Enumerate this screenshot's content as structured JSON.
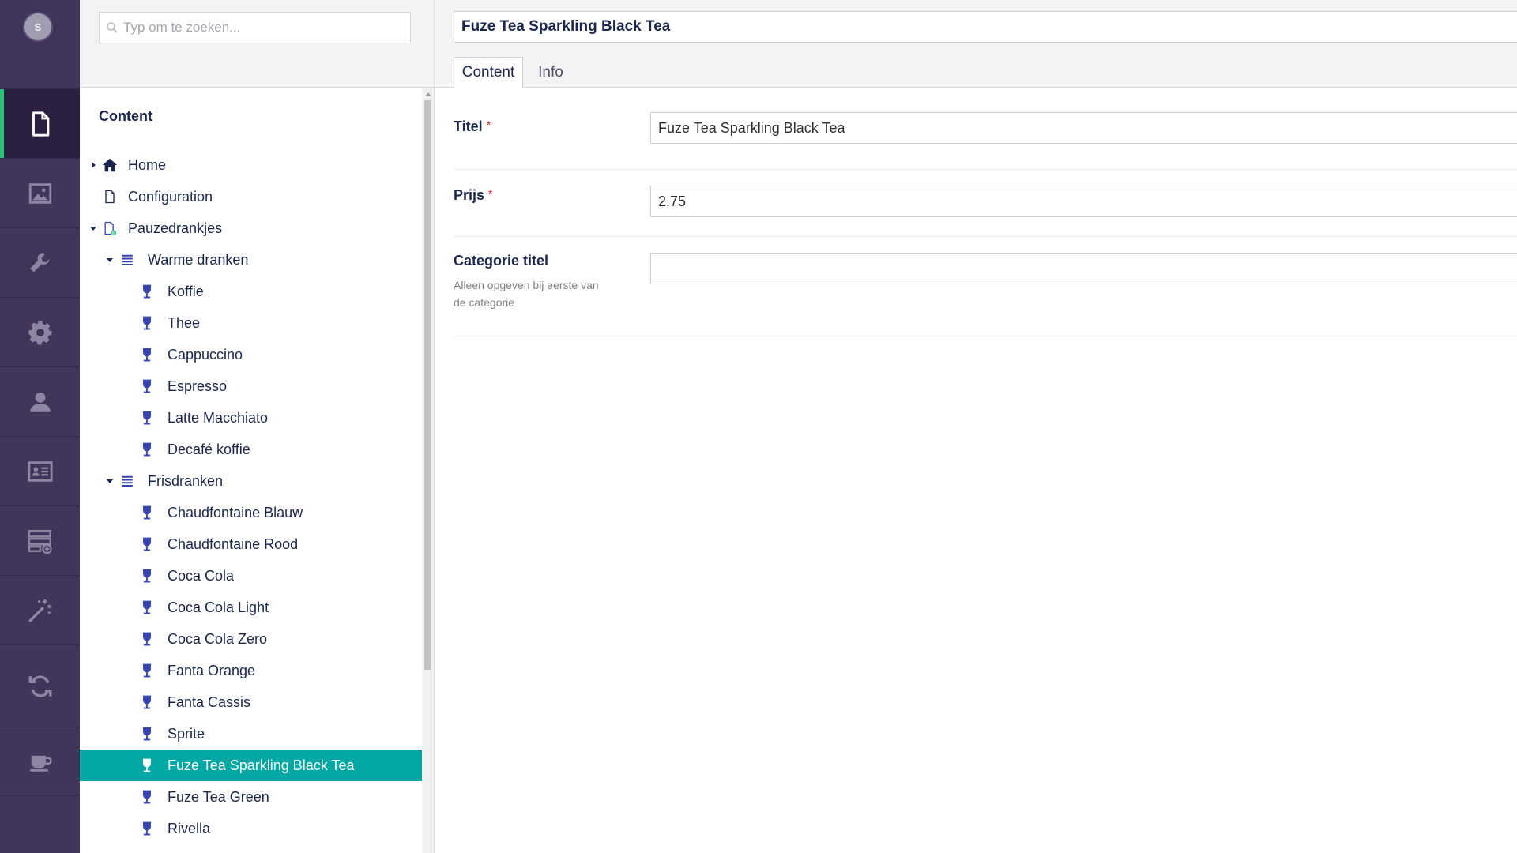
{
  "user": {
    "initial": "S"
  },
  "sections": [
    {
      "name": "content",
      "icon": "document-icon",
      "active": true
    },
    {
      "name": "media",
      "icon": "image-icon",
      "active": false
    },
    {
      "name": "settings",
      "icon": "wrench-icon",
      "active": false
    },
    {
      "name": "packages",
      "icon": "gear-icon",
      "active": false
    },
    {
      "name": "users",
      "icon": "user-icon",
      "active": false
    },
    {
      "name": "members",
      "icon": "id-card-icon",
      "active": false
    },
    {
      "name": "forms",
      "icon": "form-add-icon",
      "active": false
    },
    {
      "name": "translation",
      "icon": "magic-wand-icon",
      "active": false
    },
    {
      "name": "deploy",
      "icon": "sync-icon",
      "active": false
    },
    {
      "name": "coffee",
      "icon": "coffee-cup-icon",
      "active": false
    }
  ],
  "search": {
    "placeholder": "Typ om te zoeken..."
  },
  "tree": {
    "root_label": "Content",
    "nodes": [
      {
        "label": "Home",
        "level": 0,
        "icon": "home-icon",
        "caret": "right"
      },
      {
        "label": "Configuration",
        "level": 0,
        "icon": "page-icon",
        "caret": ""
      },
      {
        "label": "Pauzedrankjes",
        "level": 0,
        "icon": "page-plus-icon",
        "caret": "down"
      },
      {
        "label": "Warme dranken",
        "level": 1,
        "icon": "list-icon",
        "caret": "down"
      },
      {
        "label": "Koffie",
        "level": 2,
        "icon": "glass-icon",
        "caret": ""
      },
      {
        "label": "Thee",
        "level": 2,
        "icon": "glass-icon",
        "caret": ""
      },
      {
        "label": "Cappuccino",
        "level": 2,
        "icon": "glass-icon",
        "caret": ""
      },
      {
        "label": "Espresso",
        "level": 2,
        "icon": "glass-icon",
        "caret": ""
      },
      {
        "label": "Latte Macchiato",
        "level": 2,
        "icon": "glass-icon",
        "caret": ""
      },
      {
        "label": "Decafé koffie",
        "level": 2,
        "icon": "glass-icon",
        "caret": ""
      },
      {
        "label": "Frisdranken",
        "level": 1,
        "icon": "list-icon",
        "caret": "down"
      },
      {
        "label": "Chaudfontaine Blauw",
        "level": 2,
        "icon": "glass-icon",
        "caret": ""
      },
      {
        "label": "Chaudfontaine Rood",
        "level": 2,
        "icon": "glass-icon",
        "caret": ""
      },
      {
        "label": "Coca Cola",
        "level": 2,
        "icon": "glass-icon",
        "caret": ""
      },
      {
        "label": "Coca Cola Light",
        "level": 2,
        "icon": "glass-icon",
        "caret": ""
      },
      {
        "label": "Coca Cola Zero",
        "level": 2,
        "icon": "glass-icon",
        "caret": ""
      },
      {
        "label": "Fanta Orange",
        "level": 2,
        "icon": "glass-icon",
        "caret": ""
      },
      {
        "label": "Fanta Cassis",
        "level": 2,
        "icon": "glass-icon",
        "caret": ""
      },
      {
        "label": "Sprite",
        "level": 2,
        "icon": "glass-icon",
        "caret": ""
      },
      {
        "label": "Fuze Tea Sparkling Black Tea",
        "level": 2,
        "icon": "glass-icon",
        "caret": "",
        "selected": true
      },
      {
        "label": "Fuze Tea Green",
        "level": 2,
        "icon": "glass-icon",
        "caret": ""
      },
      {
        "label": "Rivella",
        "level": 2,
        "icon": "glass-icon",
        "caret": ""
      },
      {
        "label": "",
        "level": 2,
        "icon": "glass-icon",
        "caret": ""
      }
    ]
  },
  "editor": {
    "name": "Fuze Tea Sparkling Black Tea",
    "tabs": [
      {
        "label": "Content",
        "active": true
      },
      {
        "label": "Info",
        "active": false
      }
    ],
    "properties": [
      {
        "label": "Titel",
        "required": true,
        "required_mark": "*",
        "value": "Fuze Tea Sparkling Black Tea",
        "description": ""
      },
      {
        "label": "Prijs",
        "required": true,
        "required_mark": "*",
        "value": "2.75",
        "description": ""
      },
      {
        "label": "Categorie titel",
        "required": false,
        "required_mark": "",
        "value": "",
        "description": "Alleen opgeven bij eerste van de categorie"
      }
    ]
  },
  "colors": {
    "rail_bg": "#413659",
    "rail_active": "#2a1f3f",
    "rail_accent": "#2bc37c",
    "selection": "#03a7a3",
    "tree_icon": "#3544b1",
    "text": "#1b264f"
  }
}
